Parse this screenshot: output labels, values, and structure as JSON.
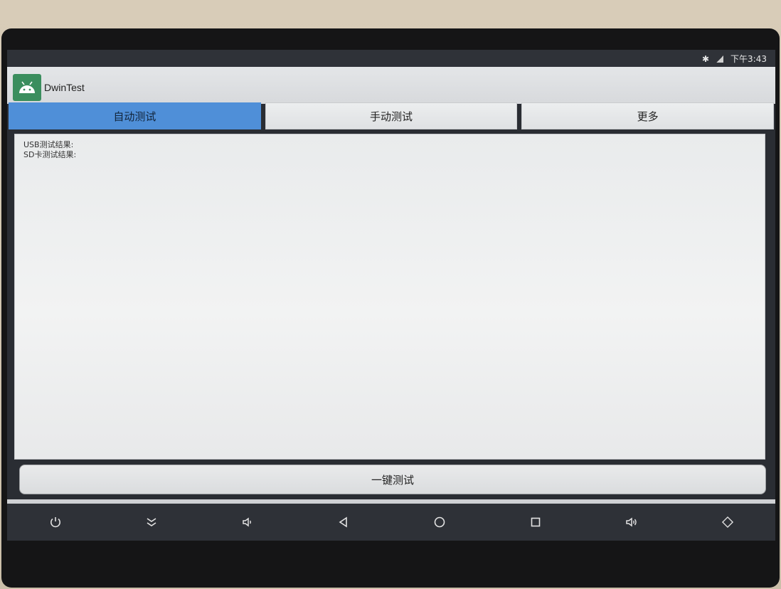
{
  "status_bar": {
    "bluetooth_icon": "bluetooth-icon",
    "signal_icon": "signal-icon",
    "time": "下午3:43"
  },
  "app": {
    "icon": "android-icon",
    "title": "DwinTest"
  },
  "tabs": [
    {
      "label": "自动测试",
      "active": true
    },
    {
      "label": "手动测试",
      "active": false
    },
    {
      "label": "更多",
      "active": false
    }
  ],
  "results": [
    {
      "label": "USB测试结果:"
    },
    {
      "label": "SD卡测试结果:"
    }
  ],
  "onekey_button": {
    "label": "一键测试"
  },
  "navbar": [
    {
      "icon": "power-icon"
    },
    {
      "icon": "collapse-icon"
    },
    {
      "icon": "volume-down-icon"
    },
    {
      "icon": "back-icon"
    },
    {
      "icon": "home-icon"
    },
    {
      "icon": "recents-icon"
    },
    {
      "icon": "volume-up-icon"
    },
    {
      "icon": "rotate-icon"
    }
  ],
  "colors": {
    "active_tab": "#4f8fd8",
    "app_icon_bg": "#3b8e5e",
    "navbar": "#2e3137"
  }
}
